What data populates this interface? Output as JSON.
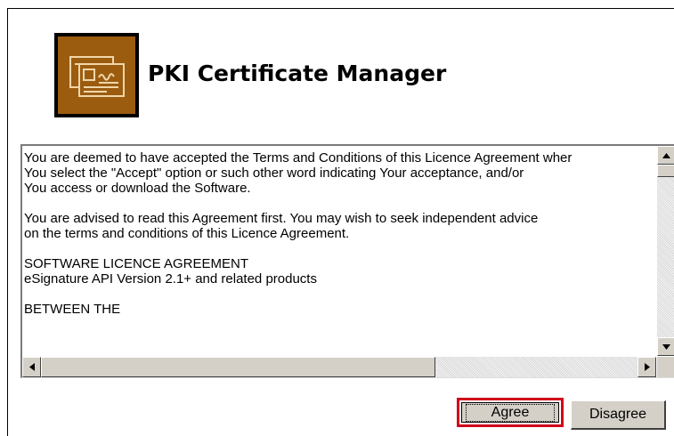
{
  "app": {
    "title": "PKI Certificate Manager",
    "logo_icon": "certificate-icon"
  },
  "licence": {
    "paragraphs": [
      [
        "You are deemed to have accepted the Terms and Conditions of this Licence Agreement wher",
        "You select the \"Accept\" option or such other word indicating Your acceptance, and/or",
        "You access or download the Software."
      ],
      [
        "You are advised to read this Agreement first.  You may wish to seek independent advice",
        "on the terms and conditions of this Licence Agreement."
      ],
      [
        "SOFTWARE LICENCE AGREEMENT",
        "eSignature API Version 2.1+ and related products"
      ],
      [
        "BETWEEN THE"
      ]
    ]
  },
  "buttons": {
    "agree_label": "Agree",
    "disagree_label": "Disagree"
  },
  "colors": {
    "logo_brown": "#9b5c10",
    "highlight_red": "#d0021b",
    "button_face": "#d4d0c8"
  }
}
